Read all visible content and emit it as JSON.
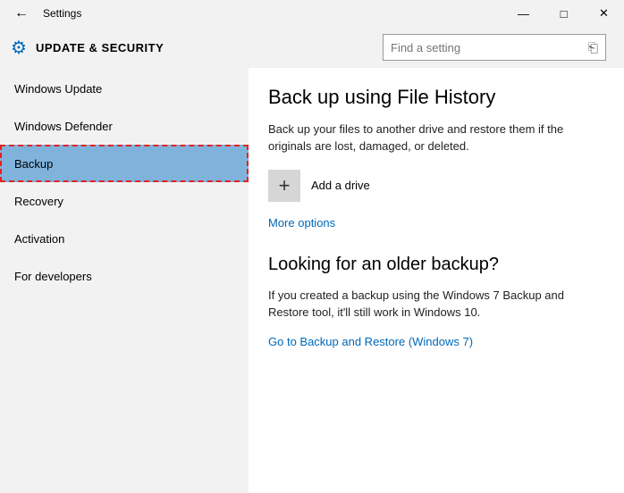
{
  "titlebar": {
    "app_title": "Settings"
  },
  "header": {
    "section_title": "UPDATE & SECURITY",
    "search_placeholder": "Find a setting"
  },
  "sidebar": {
    "items": [
      {
        "label": "Windows Update"
      },
      {
        "label": "Windows Defender"
      },
      {
        "label": "Backup"
      },
      {
        "label": "Recovery"
      },
      {
        "label": "Activation"
      },
      {
        "label": "For developers"
      }
    ]
  },
  "content": {
    "h1": "Back up using File History",
    "p1": "Back up your files to another drive and restore them if the originals are lost, damaged, or deleted.",
    "add_drive_label": "Add a drive",
    "more_options": "More options",
    "h2": "Looking for an older backup?",
    "p2": "If you created a backup using the Windows 7 Backup and Restore tool, it'll still work in Windows 10.",
    "link_w7": "Go to Backup and Restore (Windows 7)"
  }
}
